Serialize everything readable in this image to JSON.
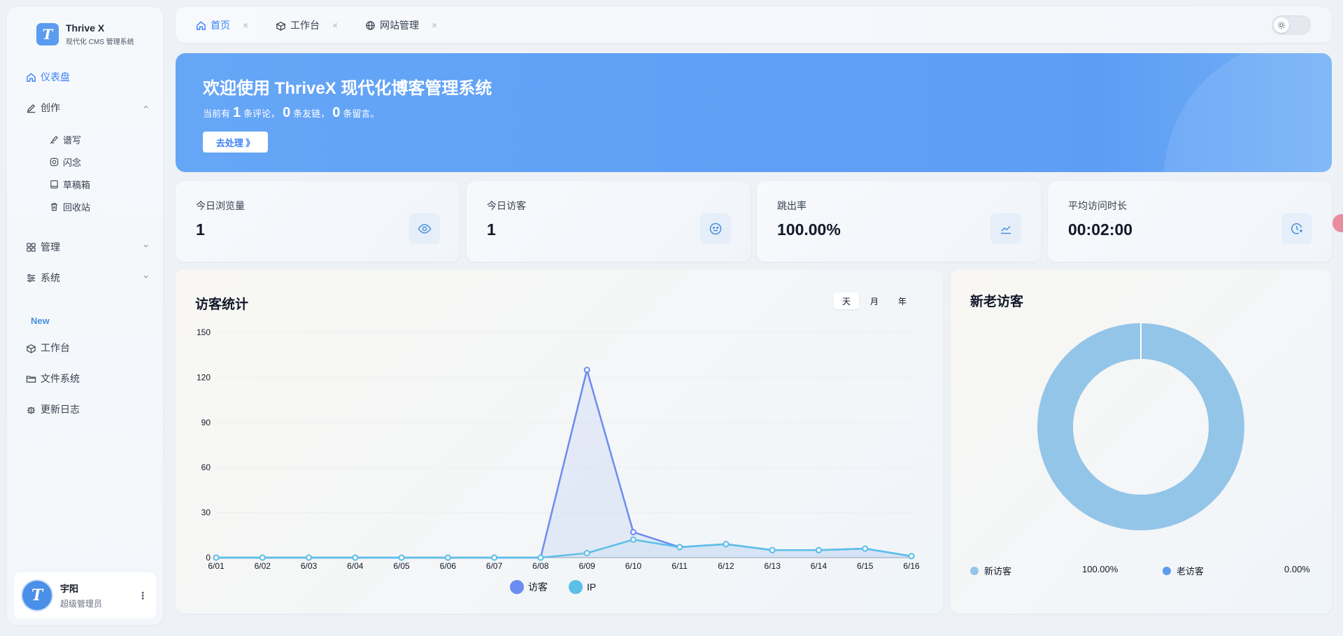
{
  "brand": {
    "name": "Thrive X",
    "subtitle": "现代化 CMS 管理系统",
    "logo_letter": "T"
  },
  "sidebar": {
    "items": [
      {
        "label": "仪表盘",
        "icon": "home-icon",
        "active": true
      },
      {
        "label": "创作",
        "icon": "pen-icon",
        "expanded": true
      },
      {
        "label": "管理",
        "icon": "grid-icon",
        "expanded": false
      },
      {
        "label": "系统",
        "icon": "sliders-icon",
        "expanded": false
      }
    ],
    "sub_items": [
      {
        "label": "谱写",
        "icon": "quill-icon"
      },
      {
        "label": "闪念",
        "icon": "camera-icon"
      },
      {
        "label": "草稿箱",
        "icon": "book-icon"
      },
      {
        "label": "回收站",
        "icon": "trash-icon"
      }
    ],
    "section_new": "New",
    "new_items": [
      {
        "label": "工作台",
        "icon": "workbench-icon"
      },
      {
        "label": "文件系统",
        "icon": "folder-icon"
      },
      {
        "label": "更新日志",
        "icon": "bug-icon"
      }
    ]
  },
  "user": {
    "name": "宇阳",
    "role": "超级管理员",
    "avatar_letter": "T",
    "more": "⋮"
  },
  "tabs": [
    {
      "label": "首页",
      "icon": "home-icon",
      "active": true
    },
    {
      "label": "工作台",
      "icon": "workbench-icon",
      "active": false
    },
    {
      "label": "网站管理",
      "icon": "globe-icon",
      "active": false
    }
  ],
  "tab_close": "×",
  "banner": {
    "title": "欢迎使用 ThriveX 现代化博客管理系统",
    "prefix": "当前有",
    "comments": "1",
    "comments_label": "条评论，",
    "links": "0",
    "links_label": "条友链，",
    "messages": "0",
    "messages_label": "条留言。",
    "button": "去处理 》"
  },
  "stats": [
    {
      "label": "今日浏览量",
      "value": "1",
      "icon": "eye-icon"
    },
    {
      "label": "今日访客",
      "value": "1",
      "icon": "face-icon"
    },
    {
      "label": "跳出率",
      "value": "100.00%",
      "icon": "trend-icon"
    },
    {
      "label": "平均访问时长",
      "value": "00:02:00",
      "icon": "clock-icon"
    }
  ],
  "visitor_card": {
    "title": "访客统计",
    "ranges": [
      "天",
      "月",
      "年"
    ],
    "selected_range": "天"
  },
  "pie_card": {
    "title": "新老访客",
    "legend": [
      {
        "label": "新访客",
        "value": "100.00%",
        "color": "#93c5e8"
      },
      {
        "label": "老访客",
        "value": "0.00%",
        "color": "#5b9cf0"
      }
    ]
  },
  "chart_data": [
    {
      "type": "line",
      "title": "访客统计",
      "categories": [
        "6/01",
        "6/02",
        "6/03",
        "6/04",
        "6/05",
        "6/06",
        "6/07",
        "6/08",
        "6/09",
        "6/10",
        "6/11",
        "6/12",
        "6/13",
        "6/14",
        "6/15",
        "6/16"
      ],
      "ylim": [
        0,
        150
      ],
      "yticks": [
        0,
        30,
        60,
        90,
        120,
        150
      ],
      "grid": true,
      "legend_position": "bottom",
      "series": [
        {
          "name": "访客",
          "color": "#6b8cf0",
          "values": [
            0,
            0,
            0,
            0,
            0,
            0,
            0,
            0,
            125,
            17,
            7,
            9,
            5,
            5,
            6,
            1
          ]
        },
        {
          "name": "IP",
          "color": "#5bbfe8",
          "values": [
            0,
            0,
            0,
            0,
            0,
            0,
            0,
            0,
            3,
            12,
            7,
            9,
            5,
            5,
            6,
            1
          ]
        }
      ]
    },
    {
      "type": "pie",
      "title": "新老访客",
      "labels": [
        "新访客",
        "老访客"
      ],
      "values": [
        100.0,
        0.0
      ],
      "colors": [
        "#93c5e8",
        "#5b9cf0"
      ],
      "donut": true
    }
  ]
}
